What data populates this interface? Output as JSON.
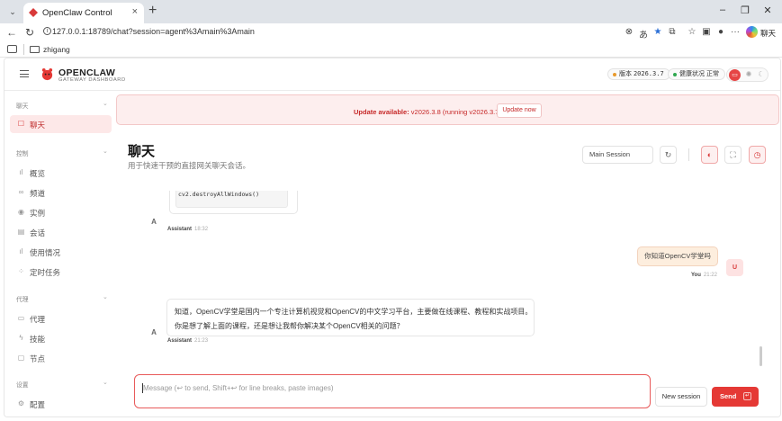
{
  "browser": {
    "tab_title": "OpenClaw Control",
    "url": "127.0.0.1:18789/chat?session=agent%3Amain%3Amain",
    "favorites_folder": "zhigang",
    "copilot_label": "聊天"
  },
  "header": {
    "brand": "OPENCLAW",
    "brand_sub": "GATEWAY DASHBOARD",
    "version_label": "版本",
    "version_value": "2026.3.7",
    "health_label": "健康状况",
    "health_value": "正常",
    "health_color": "#2fa84f",
    "version_dot_color": "#e89a2c",
    "accent": "#e53935"
  },
  "sidebar": {
    "groups": [
      {
        "label": "聊天",
        "items": [
          {
            "label": "聊天",
            "icon": "chat-bubble-icon",
            "active": true
          }
        ]
      },
      {
        "label": "控制",
        "items": [
          {
            "label": "概览",
            "icon": "bar-chart-icon"
          },
          {
            "label": "频道",
            "icon": "link-icon"
          },
          {
            "label": "实例",
            "icon": "radio-icon"
          },
          {
            "label": "会话",
            "icon": "document-icon"
          },
          {
            "label": "使用情况",
            "icon": "bar-chart-icon"
          },
          {
            "label": "定时任务",
            "icon": "loader-icon"
          }
        ]
      },
      {
        "label": "代理",
        "items": [
          {
            "label": "代理",
            "icon": "folder-icon"
          },
          {
            "label": "技能",
            "icon": "bolt-icon"
          },
          {
            "label": "节点",
            "icon": "monitor-icon"
          }
        ]
      },
      {
        "label": "设置",
        "items": [
          {
            "label": "配置",
            "icon": "gear-icon"
          }
        ]
      }
    ]
  },
  "banner": {
    "prefix": "Update available:",
    "detail": "v2026.3.8 (running v2026.3.7).",
    "button": "Update now"
  },
  "page": {
    "title": "聊天",
    "subtitle": "用于快速干预的直接网关聊天会话。",
    "session_select": "Main Session"
  },
  "messages": {
    "code_line": "cv2.destroyAllWindows()",
    "assistant_name": "Assistant",
    "assistant_avatar": "A",
    "msg1_time": "18:32",
    "user_text": "你知道OpenCV学堂吗",
    "user_name": "You",
    "user_avatar": "U",
    "user_time": "21:22",
    "assistant_line1": "知道，OpenCV学堂是国内一个专注计算机视觉和OpenCV的中文学习平台，主要做在线课程、教程和实战项目。",
    "assistant_line2": "你是想了解上面的课程，还是想让我帮你解决某个OpenCV相关的问题？",
    "msg3_time": "21:23"
  },
  "composer": {
    "placeholder": "Message (↩ to send, Shift+↩ for line breaks, paste images)",
    "new_session": "New session",
    "send": "Send"
  }
}
